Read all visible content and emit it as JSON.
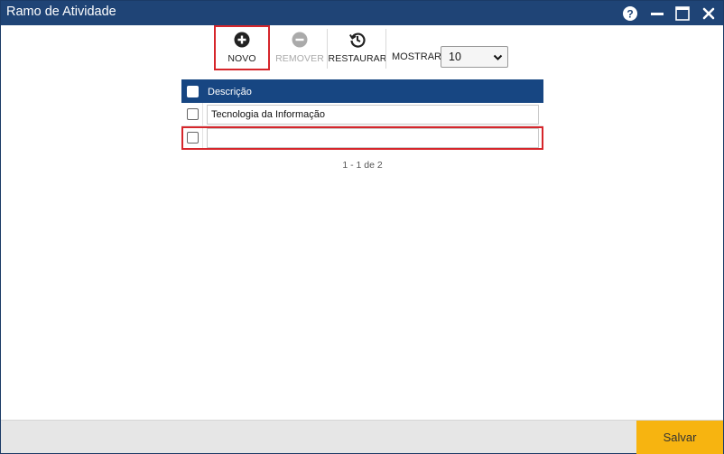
{
  "window": {
    "title": "Ramo de Atividade"
  },
  "titlebar_icons": [
    "help-icon",
    "minimize-icon",
    "maximize-icon",
    "close-icon"
  ],
  "toolbar": {
    "novo_label": "NOVO",
    "remover_label": "REMOVER",
    "restaurar_label": "RESTAURAR",
    "mostrar_label": "MOSTRAR:",
    "mostrar_value": "10"
  },
  "grid": {
    "header": "Descrição",
    "rows": [
      {
        "descricao": "Tecnologia da Informação"
      },
      {
        "descricao": ""
      }
    ]
  },
  "pager": {
    "text": "1 - 1 de 2"
  },
  "footer": {
    "salvar_label": "Salvar"
  },
  "colors": {
    "titlebar": "#1f4476",
    "grid_header": "#174682",
    "highlight": "#d6262b",
    "save_button": "#f7b410"
  }
}
